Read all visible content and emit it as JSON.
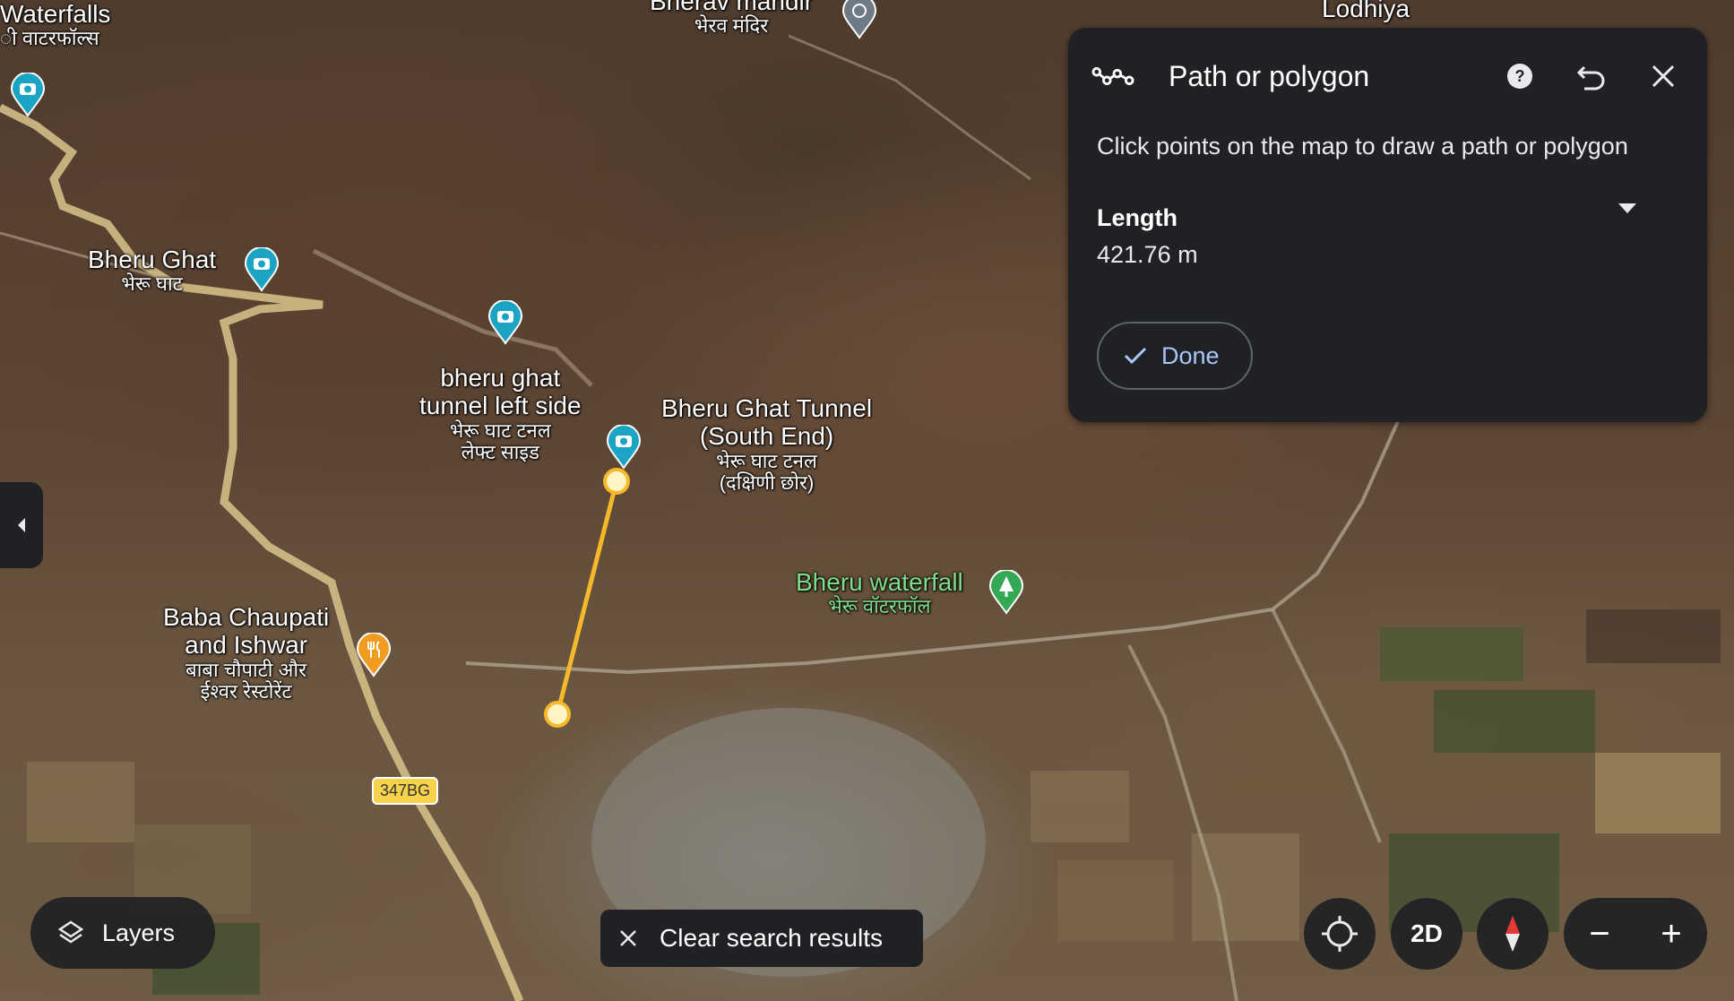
{
  "map": {
    "labels": {
      "waterfalls": {
        "en": "Waterfalls",
        "hi": "ी वाटरफॉल्स"
      },
      "bherav_mandir": {
        "en": "Bherav mandir",
        "hi": "भेरव मंदिर"
      },
      "lodhiya": {
        "en": "Lodhiya"
      },
      "bheru_ghat": {
        "en": "Bheru Ghat",
        "hi": "भेरू घाट"
      },
      "tunnel_left": {
        "en1": "bheru ghat",
        "en2": "tunnel left side",
        "hi1": "भेरू घाट टनल",
        "hi2": "लेफ्ट साइड"
      },
      "tunnel_south": {
        "en1": "Bheru Ghat Tunnel",
        "en2": "(South End)",
        "hi1": "भेरू घाट टनल",
        "hi2": "(दक्षिणी छोर)"
      },
      "waterfall": {
        "en": "Bheru waterfall",
        "hi": "भेरू वॉटरफॉल"
      },
      "baba": {
        "en1": "Baba Chaupati",
        "en2": "and Ishwar",
        "hi1": "बाबा चौपाटी और",
        "hi2": "ईश्वर रेस्टोरेंट"
      }
    },
    "road_shield": "347BG",
    "path_color": "#f6b92b",
    "pin_color": "#1ba4c4",
    "restaurant_pin_color": "#f29c1f",
    "nature_pin_color": "#34a853"
  },
  "panel": {
    "title": "Path or polygon",
    "hint": "Click points on the map to draw a path or polygon",
    "length_label": "Length",
    "length_value": "421.76 m",
    "done_label": "Done",
    "icons": [
      "path-icon",
      "help-icon",
      "undo-icon",
      "close-icon",
      "dropdown-arrow-icon",
      "check-icon"
    ]
  },
  "controls": {
    "layers_label": "Layers",
    "clear_label": "Clear search results",
    "mode_label": "2D",
    "zoom_out": "−",
    "zoom_in": "+"
  }
}
